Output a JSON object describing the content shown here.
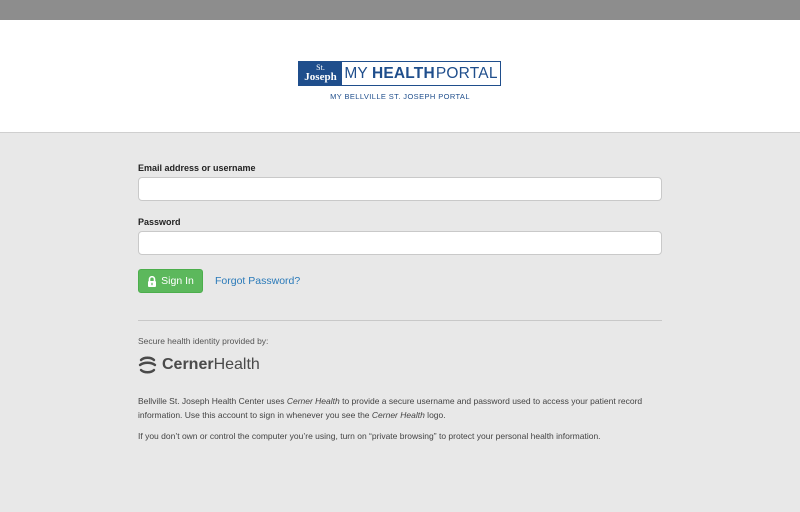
{
  "header": {
    "logo": {
      "box_top": "St.",
      "box_bottom": "Joseph",
      "word1": "MY",
      "word2": "HEALTH",
      "word3": "PORTAL"
    },
    "subtitle": "MY BELLVILLE ST. JOSEPH PORTAL"
  },
  "form": {
    "username_label": "Email address or username",
    "username_value": "",
    "password_label": "Password",
    "password_value": "",
    "signin_label": "Sign In",
    "forgot_label": "Forgot Password?"
  },
  "footer": {
    "provided_by": "Secure health identity provided by:",
    "cerner_word1": "Cerner",
    "cerner_word2": "Health",
    "para1_a": "Bellville St. Joseph Health Center uses ",
    "para1_b": "Cerner Health",
    "para1_c": " to provide a secure username and password used to access your patient record information. Use this account to sign in whenever you see the ",
    "para1_d": "Cerner Health",
    "para1_e": " logo.",
    "para2": "If you don’t own or control the computer you’re using, turn on “private browsing” to protect your personal health information."
  },
  "colors": {
    "brand_blue": "#1f4e8c",
    "signin_green": "#5cb85c",
    "link_blue": "#2a7ab9",
    "background": "#e8e8e8"
  },
  "icons": [
    "lock-icon",
    "cerner-logo-icon"
  ]
}
